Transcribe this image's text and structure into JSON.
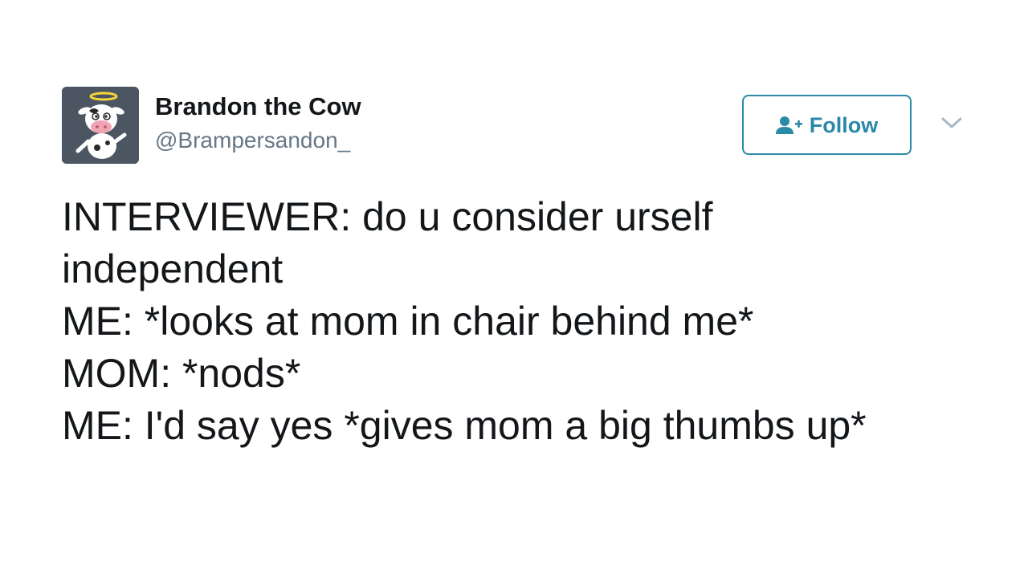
{
  "author": {
    "name": "Brandon the Cow",
    "handle": "@Brampersandon_",
    "avatar_icon": "cow-with-halo-avatar"
  },
  "follow_button": {
    "label": "Follow",
    "icon": "add-user-icon",
    "color": "#2a89a7"
  },
  "menu": {
    "icon": "chevron-down-icon"
  },
  "tweet": {
    "lines": [
      "INTERVIEWER: do u consider urself",
      "independent",
      "ME: *looks at mom in chair behind me*",
      "MOM: *nods*",
      "ME: I'd say yes *gives mom a big thumbs up*"
    ]
  }
}
